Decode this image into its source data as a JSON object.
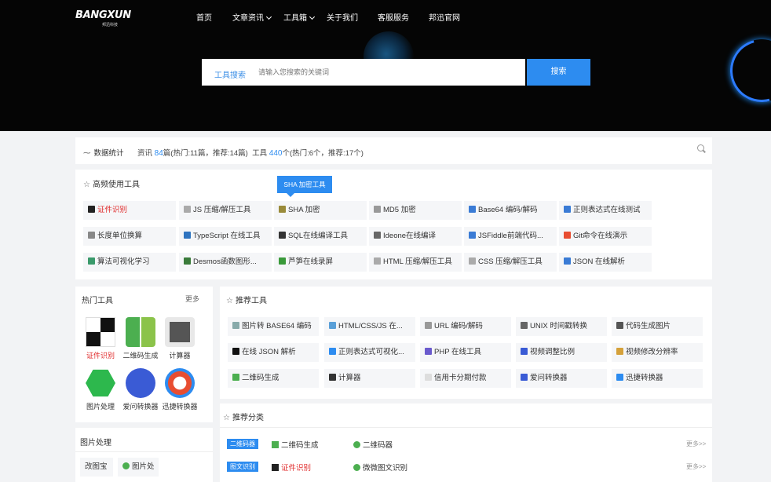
{
  "header": {
    "logo_text": "BANGXUN",
    "logo_sub": "邦迅科技",
    "nav": [
      {
        "label": "首页"
      },
      {
        "label": "文章资讯"
      },
      {
        "label": "工具箱"
      },
      {
        "label": "关于我们"
      },
      {
        "label": "客服服务"
      },
      {
        "label": "邦迅官网"
      }
    ],
    "search": {
      "label": "工具搜索",
      "placeholder": "请输入您搜索的关键词",
      "button": "搜索"
    }
  },
  "stats": {
    "label": "数据统计",
    "articles_prefix": "资讯",
    "articles_count": "84",
    "articles_suffix": "篇(热门:11篇，推荐:14篇)",
    "tools_prefix": "工具",
    "tools_count": "440",
    "tools_suffix": "个(热门:6个，推荐:17个)"
  },
  "frequent": {
    "title": "高频使用工具",
    "tooltip": "SHA 加密工具",
    "tools": [
      {
        "label": "证件识别",
        "icon": "puzzle-icon",
        "color": "#222"
      },
      {
        "label": "JS 压缩/解压工具",
        "icon": "document-icon",
        "color": "#aaa"
      },
      {
        "label": "SHA 加密",
        "icon": "lock-icon",
        "color": "#9a8b3a"
      },
      {
        "label": "MD5 加密",
        "icon": "md5-icon",
        "color": "#999"
      },
      {
        "label": "Base64 编码/解码",
        "icon": "image-icon",
        "color": "#3a7bd5"
      },
      {
        "label": "正则表达式在线测试",
        "icon": "regex-icon",
        "color": "#3a7bd5"
      },
      {
        "label": "长度单位换算",
        "icon": "ruler-icon",
        "color": "#888"
      },
      {
        "label": "TypeScript 在线工具",
        "icon": "ts-icon",
        "color": "#2f74c0"
      },
      {
        "label": "SQL在线编译工具",
        "icon": "hammer-icon",
        "color": "#333"
      },
      {
        "label": "Ideone在线编译",
        "icon": "code-icon",
        "color": "#666"
      },
      {
        "label": "JSFiddle前端代码...",
        "icon": "fiddle-icon",
        "color": "#3a7bd5"
      },
      {
        "label": "Git命令在线演示",
        "icon": "git-icon",
        "color": "#e84d31"
      },
      {
        "label": "算法可视化学习",
        "icon": "algo-icon",
        "color": "#3a9a6b"
      },
      {
        "label": "Desmos函数图形...",
        "icon": "graph-icon",
        "color": "#3a7b3a"
      },
      {
        "label": "芦笋在线录屏",
        "icon": "leaf-icon",
        "color": "#3a9a3a"
      },
      {
        "label": "HTML 压缩/解压工具",
        "icon": "html-icon",
        "color": "#aaa"
      },
      {
        "label": "CSS 压缩/解压工具",
        "icon": "css-icon",
        "color": "#aaa"
      },
      {
        "label": "JSON 在线解析",
        "icon": "json-icon",
        "color": "#3a7bd5"
      }
    ]
  },
  "hot": {
    "title": "热门工具",
    "more": "更多",
    "apps": [
      {
        "label": "证件识别",
        "icon": "puzzle-icon"
      },
      {
        "label": "二维码生成",
        "icon": "qrcode-icon"
      },
      {
        "label": "计算器",
        "icon": "calculator-icon"
      },
      {
        "label": "图片处理",
        "icon": "image-process-icon"
      },
      {
        "label": "爱问转换器",
        "icon": "aiwen-icon"
      },
      {
        "label": "迅捷转换器",
        "icon": "xunjie-icon"
      }
    ]
  },
  "recommend": {
    "title": "推荐工具",
    "tools": [
      {
        "label": "图片转 BASE64 编码",
        "icon": "image-icon",
        "color": "#8aa"
      },
      {
        "label": "HTML/CSS/JS 在...",
        "icon": "html-icon",
        "color": "#5aa0d8"
      },
      {
        "label": "URL 编码/解码",
        "icon": "link-icon",
        "color": "#999"
      },
      {
        "label": "UNIX 时间戳转换",
        "icon": "clock-icon",
        "color": "#666"
      },
      {
        "label": "代码生成图片",
        "icon": "code-image-icon",
        "color": "#555"
      },
      {
        "label": "在线 JSON 解析",
        "icon": "json-icon",
        "color": "#111"
      },
      {
        "label": "正则表达式可视化...",
        "icon": "regex-icon",
        "color": "#2d8cf0"
      },
      {
        "label": "PHP 在线工具",
        "icon": "php-icon",
        "color": "#6a5acd"
      },
      {
        "label": "视频调整比例",
        "icon": "video-icon",
        "color": "#3a5bd5"
      },
      {
        "label": "视频修改分辨率",
        "icon": "pencil-icon",
        "color": "#d5a13a"
      },
      {
        "label": "二维码生成",
        "icon": "qrcode-icon",
        "color": "#4caf50"
      },
      {
        "label": "计算器",
        "icon": "calculator-icon",
        "color": "#333"
      },
      {
        "label": "信用卡分期付款",
        "icon": "card-icon",
        "color": "#ddd"
      },
      {
        "label": "爱问转换器",
        "icon": "aiwen-icon",
        "color": "#3a5bd5"
      },
      {
        "label": "迅捷转换器",
        "icon": "xunjie-icon",
        "color": "#2d8cf0"
      }
    ]
  },
  "categories": {
    "title": "推荐分类",
    "rows": [
      {
        "badge": "二维码器",
        "links": [
          {
            "label": "二维码生成",
            "icon": "qrcode-icon"
          },
          {
            "label": "二维码器",
            "icon": "wechat-icon"
          }
        ],
        "more": "更多>>"
      },
      {
        "badge": "图文识别",
        "links": [
          {
            "label": "证件识别",
            "icon": "puzzle-icon"
          },
          {
            "label": "微微图文识别",
            "icon": "wechat-icon"
          }
        ],
        "more": "更多>>"
      }
    ]
  },
  "image_panel": {
    "title": "图片处理",
    "items": [
      {
        "label": "改图宝"
      },
      {
        "label": "图片处"
      }
    ]
  }
}
